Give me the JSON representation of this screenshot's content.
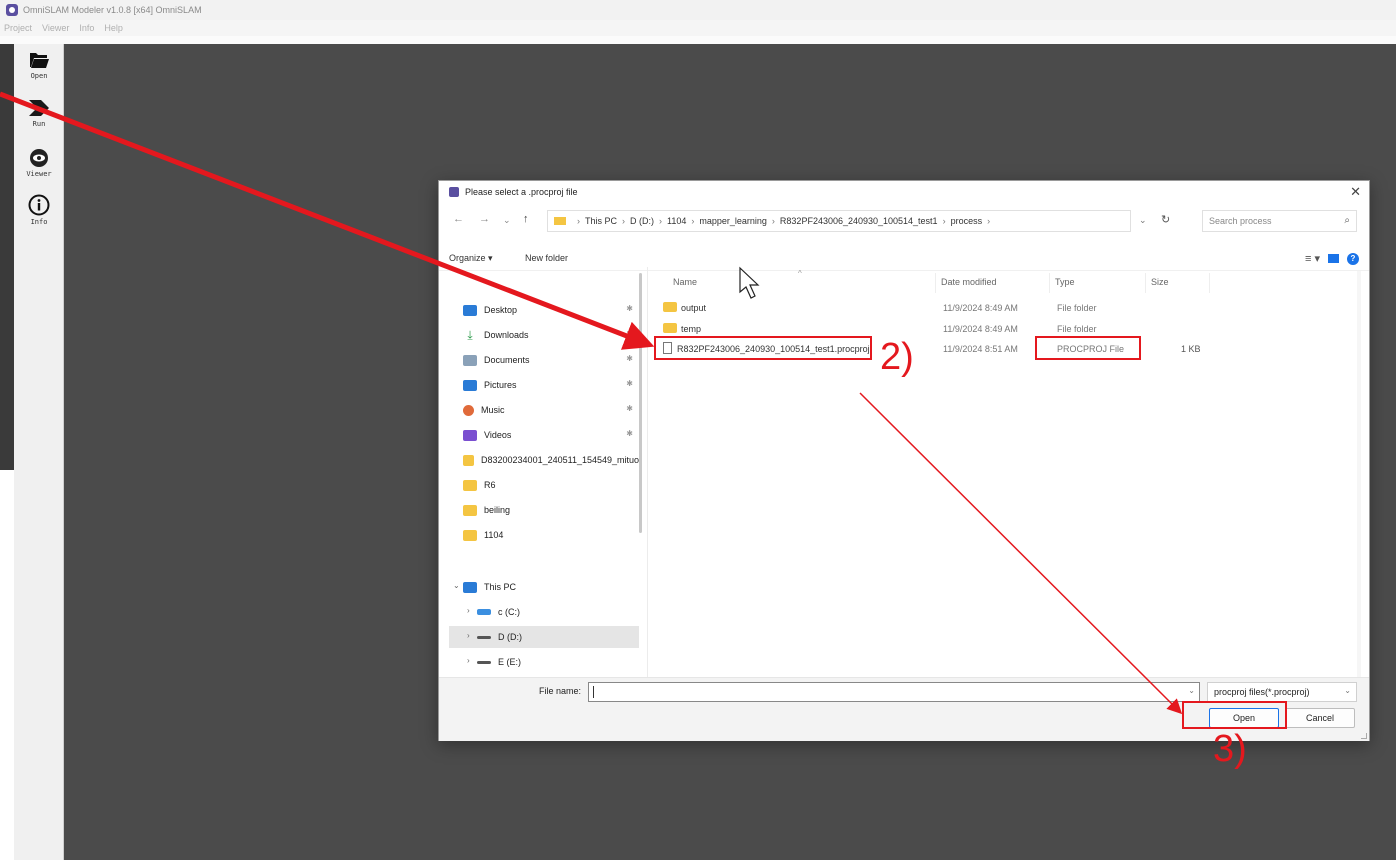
{
  "app": {
    "title": "OmniSLAM Modeler v1.0.8 [x64]  OmniSLAM",
    "menu": [
      "Project",
      "Viewer",
      "Info",
      "Help"
    ],
    "toolbar": [
      {
        "label": "Open",
        "icon": "folder-open-icon"
      },
      {
        "label": "Run",
        "icon": "run-arrow-icon"
      },
      {
        "label": "Viewer",
        "icon": "eye-icon"
      },
      {
        "label": "Info",
        "icon": "info-icon"
      }
    ]
  },
  "dialog": {
    "title": "Please select a .procproj file",
    "breadcrumb": [
      "This PC",
      "D (D:)",
      "1104",
      "mapper_learning",
      "R832PF243006_240930_100514_test1",
      "process"
    ],
    "search_placeholder": "Search process",
    "organize_label": "Organize ▾",
    "new_folder_label": "New folder",
    "nav_items": [
      {
        "label": "Desktop",
        "icon": "desktop-icon",
        "pinned": true,
        "color": "#2a7bd6"
      },
      {
        "label": "Downloads",
        "icon": "download-icon",
        "pinned": true,
        "color": "#2c9a4a"
      },
      {
        "label": "Documents",
        "icon": "documents-icon",
        "pinned": true,
        "color": "#8aa1b8"
      },
      {
        "label": "Pictures",
        "icon": "pictures-icon",
        "pinned": true,
        "color": "#2a7bd6"
      },
      {
        "label": "Music",
        "icon": "music-icon",
        "pinned": true,
        "color": "#e06a3a"
      },
      {
        "label": "Videos",
        "icon": "videos-icon",
        "pinned": true,
        "color": "#7a4fd0"
      },
      {
        "label": "D83200234001_240511_154549_mituo",
        "icon": "folder-icon",
        "pinned": false,
        "color": "#f4c542"
      },
      {
        "label": "R6",
        "icon": "folder-icon",
        "pinned": false,
        "color": "#f4c542"
      },
      {
        "label": "beiling",
        "icon": "folder-icon",
        "pinned": false,
        "color": "#f4c542"
      },
      {
        "label": "1104",
        "icon": "folder-icon",
        "pinned": false,
        "color": "#f4c542"
      }
    ],
    "tree": [
      {
        "label": "This PC",
        "arrow": "⌄",
        "color": "#2a7bd6"
      },
      {
        "label": "c (C:)",
        "arrow": "›",
        "color": "#3b8fe0"
      },
      {
        "label": "D (D:)",
        "arrow": "›",
        "color": "#555555",
        "selected": true
      },
      {
        "label": "E (E:)",
        "arrow": "›",
        "color": "#555555"
      }
    ],
    "columns": [
      "Name",
      "Date modified",
      "Type",
      "Size"
    ],
    "files": [
      {
        "name": "output",
        "date": "11/9/2024 8:49 AM",
        "type": "File folder",
        "size": "",
        "kind": "folder"
      },
      {
        "name": "temp",
        "date": "11/9/2024 8:49 AM",
        "type": "File folder",
        "size": "",
        "kind": "folder"
      },
      {
        "name": "R832PF243006_240930_100514_test1.procproj",
        "date": "11/9/2024 8:51 AM",
        "type": "PROCPROJ File",
        "size": "1 KB",
        "kind": "file"
      }
    ],
    "file_name_label": "File name:",
    "file_name_value": "",
    "filter": "procproj files(*.procproj)",
    "open_label": "Open",
    "cancel_label": "Cancel"
  },
  "annotations": {
    "step2": "2)",
    "step3": "3)",
    "color": "#e4181e"
  }
}
